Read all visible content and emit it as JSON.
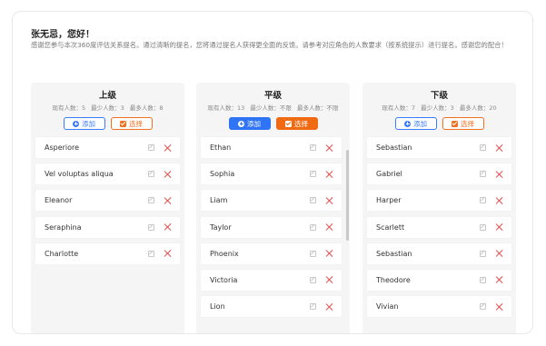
{
  "greeting": "张无忌，您好！",
  "intro": "感谢您参与本次360度评估关系提名。通过清晰的提名，您将通过提名人获得更全面的反馈。请参考对应角色的人数要求（按系统提示）进行提名。感谢您的配合！",
  "colors": {
    "accent_blue": "#2f74f6",
    "accent_orange": "#f06a12",
    "delete_red": "#e84848"
  },
  "buttons": {
    "add": "添加",
    "select": "选择"
  },
  "columns": [
    {
      "title": "上级",
      "stats": [
        "现有人数：5",
        "最少人数：3",
        "最多人数：8"
      ],
      "items": [
        "Asperiore",
        "Vel voluptas aliqua",
        "Eleanor",
        "Seraphina",
        "Charlotte"
      ]
    },
    {
      "title": "平级",
      "stats": [
        "现有人数：13",
        "最少人数：不限",
        "最多人数：不限"
      ],
      "items": [
        "Ethan",
        "Sophia",
        "Liam",
        "Taylor",
        "Phoenix",
        "Victoria",
        "Lion"
      ]
    },
    {
      "title": "下级",
      "stats": [
        "现有人数：7",
        "最少人数：3",
        "最多人数：20"
      ],
      "items": [
        "Sebastian",
        "Gabriel",
        "Harper",
        "Scarlett",
        "Sebastian",
        "Theodore",
        "Vivian"
      ]
    }
  ]
}
